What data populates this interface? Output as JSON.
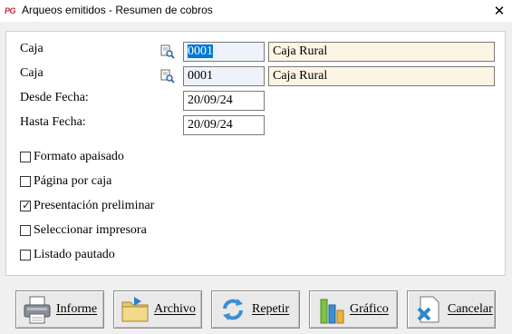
{
  "window": {
    "title": "Arqueos emitidos - Resumen de cobros",
    "app_logo": "PG",
    "close_glyph": "✕"
  },
  "form": {
    "caja_from": {
      "label": "Caja",
      "code": "0001",
      "name": "Caja Rural"
    },
    "caja_to": {
      "label": "Caja",
      "code": "0001",
      "name": "Caja Rural"
    },
    "desde": {
      "label": "Desde Fecha:",
      "value": "20/09/24"
    },
    "hasta": {
      "label": "Hasta Fecha:",
      "value": "20/09/24"
    }
  },
  "options": [
    {
      "label": "Formato apaisado",
      "checked": false
    },
    {
      "label": "Página por caja",
      "checked": false
    },
    {
      "label": "Presentación preliminar",
      "checked": true
    },
    {
      "label": "Seleccionar impresora",
      "checked": false
    },
    {
      "label": "Listado pautado",
      "checked": false
    }
  ],
  "buttons": {
    "informe": {
      "label": "Informe",
      "icon": "printer-icon"
    },
    "archivo": {
      "label": "Archivo",
      "icon": "folder-icon"
    },
    "repetir": {
      "label": "Repetir",
      "icon": "refresh-icon"
    },
    "grafico": {
      "label": "Gráfico",
      "icon": "bar-chart-icon"
    },
    "cancelar": {
      "label": "Cancelar",
      "icon": "cancel-document-icon"
    }
  },
  "colors": {
    "selection": "#0078d7",
    "name_field_bg": "#fdf5e4",
    "code_field_bg": "#eef3fb"
  }
}
